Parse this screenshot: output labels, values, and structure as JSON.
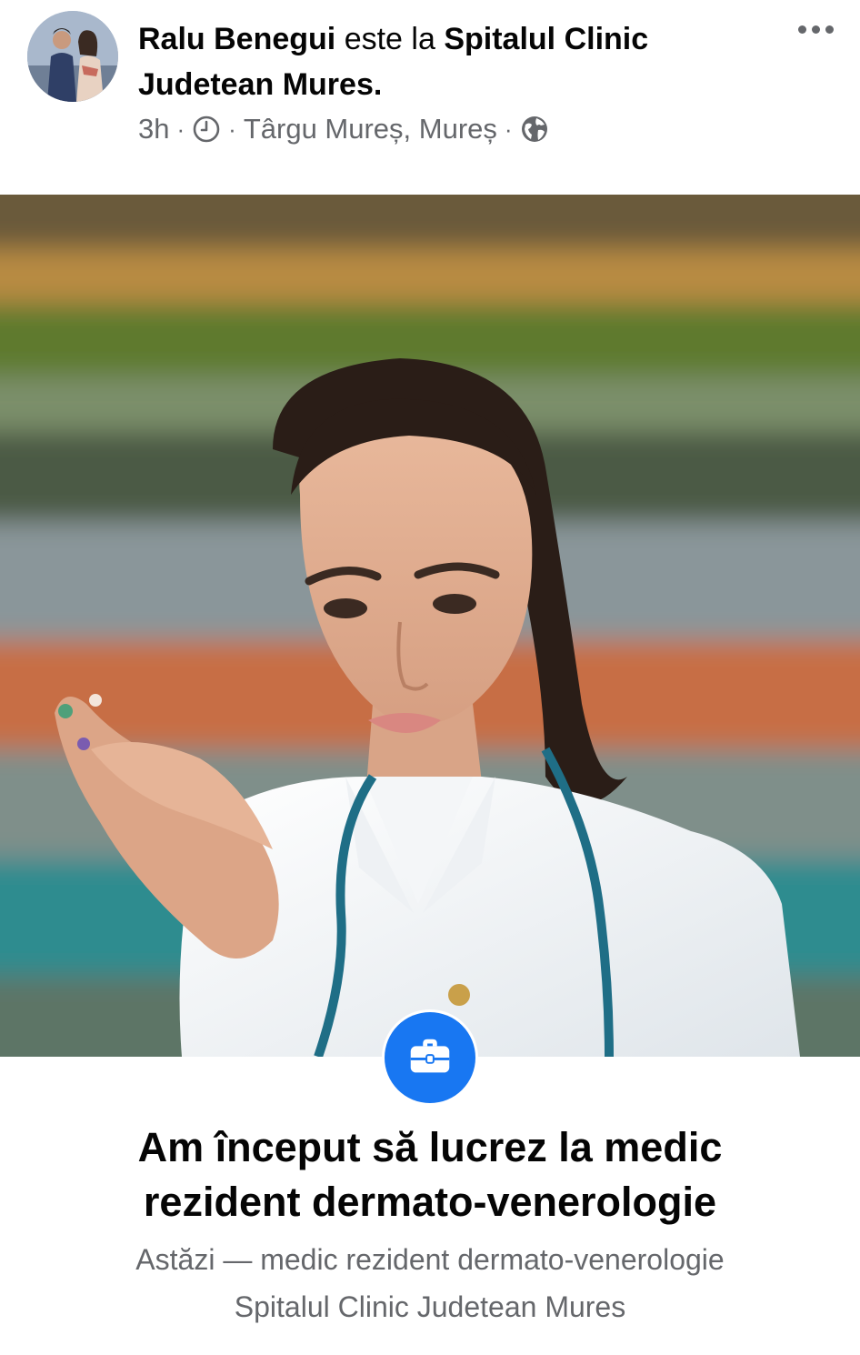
{
  "post": {
    "author": "Ralu Benegui",
    "connector": "este la",
    "place_line1": "Spitalul Clinic",
    "place_line2": "Judetean Mures.",
    "time": "3h",
    "separator": "·",
    "location": "Târgu Mureș, Mureș"
  },
  "icons": {
    "avatar": "avatar-photo",
    "clock": "clock-icon",
    "audience": "globe-icon",
    "more": "more-options-icon",
    "life_event": "briefcase-icon"
  },
  "life_event": {
    "title_line1": "Am început să lucrez la medic",
    "title_line2": "rezident dermato-venerologie",
    "detail_line1": "Astăzi — medic rezident dermato-venerologie",
    "detail_line2": "Spitalul Clinic Judetean Mures"
  },
  "colors": {
    "primary_text": "#050505",
    "secondary_text": "#65676b",
    "accent": "#1877f2",
    "background": "#ffffff"
  }
}
